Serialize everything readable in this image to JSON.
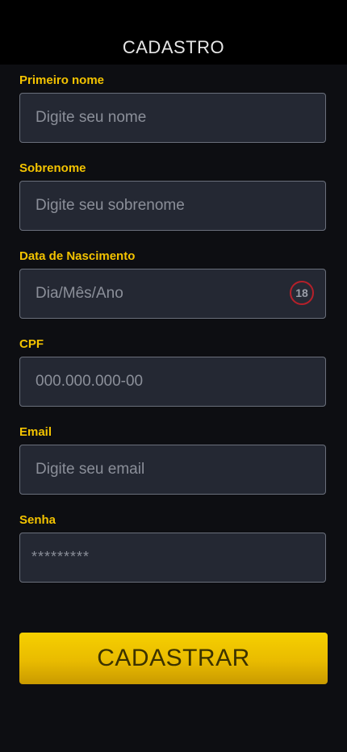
{
  "header": {
    "title": "CADASTRO"
  },
  "form": {
    "first_name": {
      "label": "Primeiro nome",
      "placeholder": "Digite seu nome"
    },
    "last_name": {
      "label": "Sobrenome",
      "placeholder": "Digite seu sobrenome"
    },
    "birth_date": {
      "label": "Data de Nascimento",
      "placeholder": "Dia/Mês/Ano",
      "age_badge": "18"
    },
    "cpf": {
      "label": "CPF",
      "placeholder": "000.000.000-00"
    },
    "email": {
      "label": "Email",
      "placeholder": "Digite seu email"
    },
    "password": {
      "label": "Senha",
      "placeholder": "*********"
    },
    "submit_label": "CADASTRAR"
  },
  "colors": {
    "background": "#0d0e12",
    "header": "#000000",
    "label": "#f3c300",
    "field_background": "#242833",
    "field_border": "#6a6f7b",
    "age_badge_border": "#b5202a",
    "button": "#f0c500",
    "button_text": "#3b3200"
  }
}
